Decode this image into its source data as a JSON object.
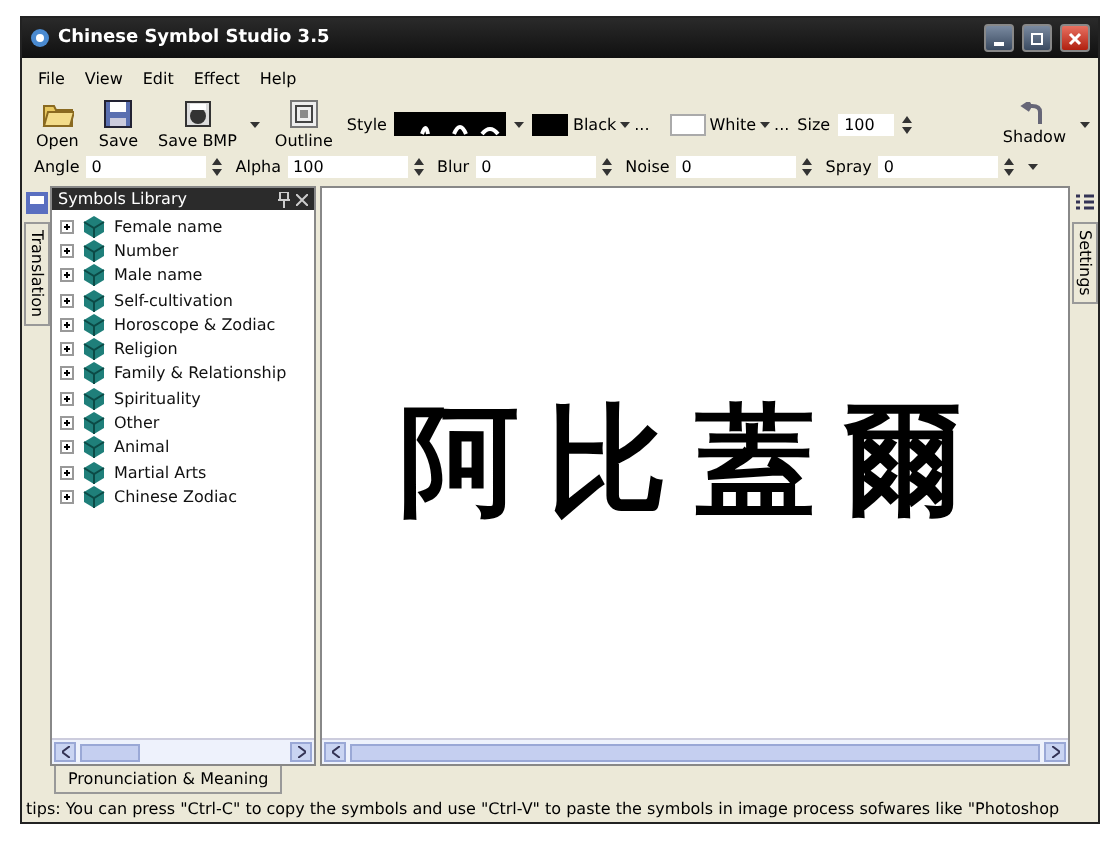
{
  "window": {
    "title": "Chinese Symbol Studio 3.5"
  },
  "menu": [
    "File",
    "View",
    "Edit",
    "Effect",
    "Help"
  ],
  "toolbar": {
    "buttons": [
      {
        "label": "Open",
        "kind": "open"
      },
      {
        "label": "Save",
        "kind": "save"
      },
      {
        "label": "Save BMP",
        "kind": "savebmp"
      },
      {
        "label": "Outline",
        "kind": "outline"
      }
    ],
    "style_label": "Style",
    "foreground": "Black",
    "foreground_more": "...",
    "background": "White",
    "background_more": "...",
    "size_label": "Size",
    "size": "100",
    "shadow": "Shadow"
  },
  "effects": [
    {
      "label": "Angle",
      "value": "0"
    },
    {
      "label": "Alpha",
      "value": "100"
    },
    {
      "label": "Blur",
      "value": "0"
    },
    {
      "label": "Noise",
      "value": "0"
    },
    {
      "label": "Spray",
      "value": "0"
    }
  ],
  "left_tab": "Translation",
  "right_tab": "Settings",
  "library": {
    "title": "Symbols Library",
    "items": [
      {
        "label": "Female name",
        "expanded": false
      },
      {
        "label": "Number",
        "expanded": false
      },
      {
        "label": "Male name",
        "expanded": false
      },
      {
        "label": "Self-cultivation",
        "expanded": false
      },
      {
        "label": "Horoscope & Zodiac",
        "expanded": false
      },
      {
        "label": "Religion",
        "expanded": false
      },
      {
        "label": "Family & Relationship",
        "expanded": false
      },
      {
        "label": "Spirituality",
        "expanded": false
      },
      {
        "label": "Other",
        "expanded": false
      },
      {
        "label": "Animal",
        "expanded": false
      },
      {
        "label": "Martial Arts",
        "expanded": false
      },
      {
        "label": "Chinese Zodiac",
        "expanded": false
      }
    ]
  },
  "canvas": {
    "text": "阿比蓋爾"
  },
  "bottom_tab": "Pronunciation & Meaning",
  "status_bar": "tips: You can press \"Ctrl-C\" to copy the symbols and use \"Ctrl-V\" to paste the symbols in image process sofwares like \"Photoshop"
}
